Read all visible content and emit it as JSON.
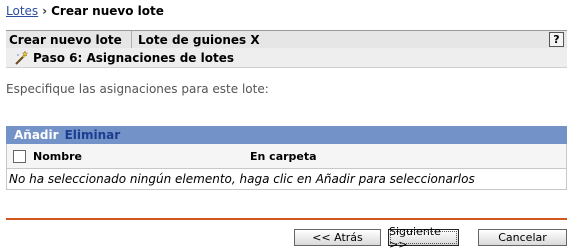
{
  "breadcrumb": {
    "root_link": "Lotes",
    "current": "Crear nuevo lote"
  },
  "header": {
    "title": "Crear nuevo lote",
    "subtitle": "Lote de guiones X",
    "help_label": "?"
  },
  "step": {
    "title": "Paso 6: Asignaciones de lotes",
    "icon": "wand-icon"
  },
  "instructions": "Especifique las asignaciones para este lote:",
  "table": {
    "toolbar": {
      "add_label": "Añadir",
      "remove_label": "Eliminar"
    },
    "columns": [
      "Nombre",
      "En carpeta"
    ],
    "empty_message": "No ha seleccionado ningún elemento, haga clic en Añadir para seleccionarlos"
  },
  "buttons": {
    "back": "<< Atrás",
    "next": "Siguiente >>",
    "cancel": "Cancelar"
  },
  "colors": {
    "link": "#2b4f9e",
    "toolbar_bg": "#7392c8",
    "divider": "#d2561e"
  }
}
